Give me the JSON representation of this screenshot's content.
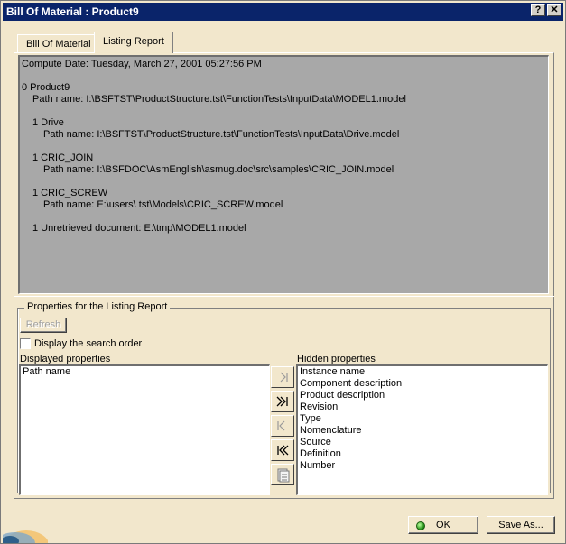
{
  "window": {
    "title": "Bill Of Material : Product9",
    "help_label": "?",
    "close_label": "✕"
  },
  "tabs": [
    {
      "label": "Bill Of Material",
      "active": false
    },
    {
      "label": "Listing Report",
      "active": true
    }
  ],
  "report": {
    "lines": [
      "Compute Date: Tuesday, March 27, 2001 05:27:56 PM",
      "0 Product9",
      "Path name: I:\\BSFTST\\ProductStructure.tst\\FunctionTests\\InputData\\MODEL1.model",
      "1 Drive",
      "Path name: I:\\BSFTST\\ProductStructure.tst\\FunctionTests\\InputData\\Drive.model",
      "1 CRIC_JOIN",
      "Path name: I:\\BSFDOC\\AsmEnglish\\asmug.doc\\src\\samples\\CRIC_JOIN.model",
      "1 CRIC_SCREW",
      "Path name: E:\\users\\ tst\\Models\\CRIC_SCREW.model",
      "1 Unretrieved document: E:\\tmp\\MODEL1.model"
    ]
  },
  "properties": {
    "group_title": "Properties for the Listing Report",
    "refresh_label": "Refresh",
    "search_order_label": "Display the search order",
    "search_order_checked": false,
    "displayed_label": "Displayed properties",
    "hidden_label": "Hidden properties",
    "displayed_items": [
      "Path name"
    ],
    "hidden_items": [
      "Instance name",
      "Component description",
      "Product description",
      "Revision",
      "Type",
      "Nomenclature",
      "Source",
      "Definition",
      "Number"
    ]
  },
  "buttons": {
    "ok_label": "OK",
    "save_as_label": "Save As..."
  }
}
